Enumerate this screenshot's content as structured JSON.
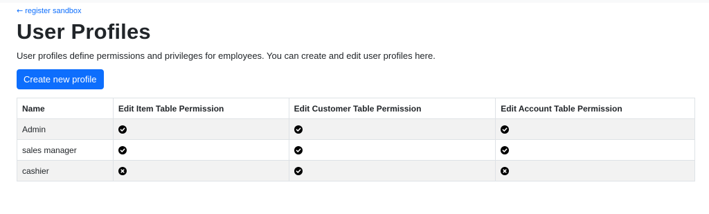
{
  "nav": {
    "back_arrow": "←",
    "back_label": "register sandbox"
  },
  "page": {
    "title": "User Profiles",
    "description": "User profiles define permissions and privileges for employees. You can create and edit user profiles here.",
    "create_button": "Create new profile"
  },
  "table": {
    "headers": [
      "Name",
      "Edit Item Table Permission",
      "Edit Customer Table Permission",
      "Edit Account Table Permission"
    ],
    "rows": [
      {
        "name": "Admin",
        "item": "check-icon",
        "customer": "check-icon",
        "account": "check-icon"
      },
      {
        "name": "sales manager",
        "item": "check-icon",
        "customer": "check-icon",
        "account": "check-icon"
      },
      {
        "name": "cashier",
        "item": "x-icon",
        "customer": "check-icon",
        "account": "x-icon"
      }
    ]
  },
  "colors": {
    "accent": "#0d6efd",
    "stripe": "#f2f2f2",
    "border": "#dee2e6"
  }
}
